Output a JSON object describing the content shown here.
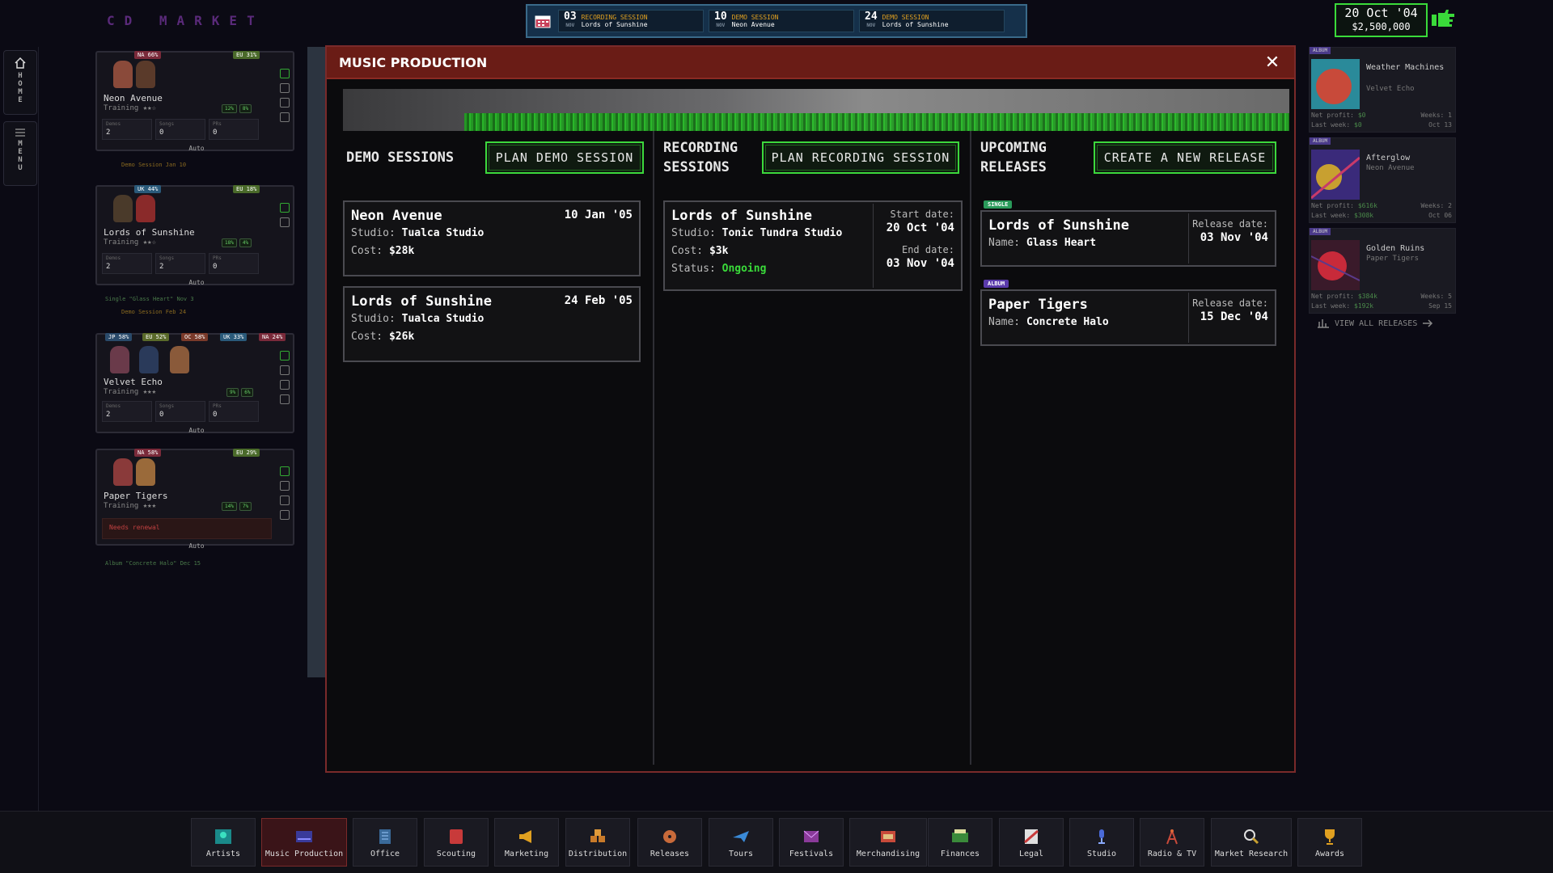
{
  "app": {
    "logo": "CD MARKET"
  },
  "calendar": {
    "events": [
      {
        "day": "03",
        "month": "NOV",
        "type": "RECORDING SESSION",
        "name": "Lords of Sunshine"
      },
      {
        "day": "10",
        "month": "NOV",
        "type": "DEMO SESSION",
        "name": "Neon Avenue"
      },
      {
        "day": "24",
        "month": "NOV",
        "type": "DEMO SESSION",
        "name": "Lords of Sunshine"
      }
    ]
  },
  "status": {
    "date": "20 Oct '04",
    "money": "$2,500,000"
  },
  "leftnav": {
    "home": [
      "H",
      "O",
      "M",
      "E"
    ],
    "menu": [
      "M",
      "E",
      "N",
      "U"
    ]
  },
  "artists": [
    {
      "name": "Neon Avenue",
      "training": "Training ★★☆",
      "tags": [
        "NA 66%",
        "EU 31%"
      ],
      "chips": [
        "12%",
        "8%"
      ],
      "demos_label": "Demos",
      "demos": "2",
      "songs_label": "Songs",
      "songs": "0",
      "prs_label": "PRs",
      "prs": "0",
      "auto": "Auto",
      "notes": [
        "Demo Session Jan 10"
      ]
    },
    {
      "name": "Lords of Sunshine",
      "training": "Training ★★☆",
      "tags": [
        "UK 44%",
        "EU 18%"
      ],
      "chips": [
        "18%",
        "4%"
      ],
      "demos_label": "Demos",
      "demos": "2",
      "songs_label": "Songs",
      "songs": "2",
      "prs_label": "PRs",
      "prs": "0",
      "auto": "Auto",
      "notes": [
        "Single \"Glass Heart\" Nov 3",
        "Demo Session Feb 24"
      ]
    },
    {
      "name": "Velvet Echo",
      "training": "Training ★★★",
      "tags": [
        "JP 58%",
        "EU 52%",
        "OC 58%",
        "UK 33%",
        "NA 24%"
      ],
      "chips": [
        "9%",
        "6%"
      ],
      "demos_label": "Demos",
      "demos": "2",
      "songs_label": "Songs",
      "songs": "0",
      "prs_label": "PRs",
      "prs": "0",
      "auto": "Auto",
      "notes": []
    },
    {
      "name": "Paper Tigers",
      "training": "Training ★★★",
      "tags": [
        "NA 58%",
        "EU 29%"
      ],
      "chips": [
        "14%",
        "7%"
      ],
      "renewal": "Needs renewal",
      "auto": "Auto",
      "notes": [
        "Album \"Concrete Halo\" Dec 15"
      ]
    }
  ],
  "modal": {
    "title": "MUSIC PRODUCTION",
    "close": "✕",
    "demo": {
      "title": "DEMO SESSIONS",
      "button": "PLAN DEMO SESSION",
      "sessions": [
        {
          "artist": "Neon Avenue",
          "date": "10 Jan '05",
          "studio_label": "Studio:",
          "studio": "Tualca Studio",
          "cost_label": "Cost:",
          "cost": "$28k"
        },
        {
          "artist": "Lords of Sunshine",
          "date": "24 Feb '05",
          "studio_label": "Studio:",
          "studio": "Tualca Studio",
          "cost_label": "Cost:",
          "cost": "$26k"
        }
      ]
    },
    "recording": {
      "title_line1": "RECORDING",
      "title_line2": "SESSIONS",
      "button": "PLAN RECORDING SESSION",
      "sessions": [
        {
          "artist": "Lords of Sunshine",
          "studio_label": "Studio:",
          "studio": "Tonic Tundra Studio",
          "cost_label": "Cost:",
          "cost": "$3k",
          "status_label": "Status:",
          "status": "Ongoing",
          "start_label": "Start date:",
          "start": "20 Oct '04",
          "end_label": "End date:",
          "end": "03 Nov '04"
        }
      ]
    },
    "releases": {
      "title_line1": "UPCOMING",
      "title_line2": "RELEASES",
      "button": "CREATE A NEW RELEASE",
      "items": [
        {
          "kind": "SINGLE",
          "artist": "Lords of Sunshine",
          "name_label": "Name:",
          "name": "Glass Heart",
          "date_label": "Release date:",
          "date": "03 Nov '04"
        },
        {
          "kind": "ALBUM",
          "artist": "Paper Tigers",
          "name_label": "Name:",
          "name": "Concrete Halo",
          "date_label": "Release date:",
          "date": "15 Dec '04"
        }
      ]
    }
  },
  "recent_releases": [
    {
      "kind": "ALBUM",
      "title": "Weather Machines",
      "artist": "Velvet Echo",
      "net_label": "Net profit:",
      "net": "$0",
      "weeks_label": "Weeks:",
      "weeks": "1",
      "last_label": "Last week:",
      "last": "$0",
      "date": "Oct 13"
    },
    {
      "kind": "ALBUM",
      "title": "Afterglow",
      "artist": "Neon Avenue",
      "net_label": "Net profit:",
      "net": "$616k",
      "weeks_label": "Weeks:",
      "weeks": "2",
      "last_label": "Last week:",
      "last": "$308k",
      "date": "Oct 06"
    },
    {
      "kind": "ALBUM",
      "title": "Golden Ruins",
      "artist": "Paper Tigers",
      "net_label": "Net profit:",
      "net": "$384k",
      "weeks_label": "Weeks:",
      "weeks": "5",
      "last_label": "Last week:",
      "last": "$192k",
      "date": "Sep 15"
    }
  ],
  "view_all": "VIEW ALL RELEASES",
  "bottom_nav": [
    {
      "label": "Artists",
      "icon": "artists-icon",
      "active": false
    },
    {
      "label": "Music Production",
      "icon": "music-production-icon",
      "active": true
    },
    {
      "label": "Office",
      "icon": "office-icon",
      "active": false
    },
    {
      "label": "Scouting",
      "icon": "scouting-icon",
      "active": false
    },
    {
      "label": "Marketing",
      "icon": "marketing-icon",
      "active": false
    },
    {
      "label": "Distribution",
      "icon": "distribution-icon",
      "active": false
    },
    {
      "label": "Releases",
      "icon": "releases-icon",
      "active": false
    },
    {
      "label": "Tours",
      "icon": "tours-icon",
      "active": false
    },
    {
      "label": "Festivals",
      "icon": "festivals-icon",
      "active": false
    },
    {
      "label": "Merchandising",
      "icon": "merchandising-icon",
      "active": false
    },
    {
      "label": "Finances",
      "icon": "finances-icon",
      "active": false
    },
    {
      "label": "Legal",
      "icon": "legal-icon",
      "active": false
    },
    {
      "label": "Studio",
      "icon": "studio-icon",
      "active": false
    },
    {
      "label": "Radio & TV",
      "icon": "radio-tv-icon",
      "active": false
    },
    {
      "label": "Market Research",
      "icon": "market-research-icon",
      "active": false
    },
    {
      "label": "Awards",
      "icon": "awards-icon",
      "active": false
    }
  ],
  "colors": {
    "accent_green": "#3cd83c",
    "modal_header": "#6a1c16",
    "status_ongoing": "#3adb3a",
    "single_badge": "#2a9a5a",
    "album_badge": "#5a3aaa"
  }
}
